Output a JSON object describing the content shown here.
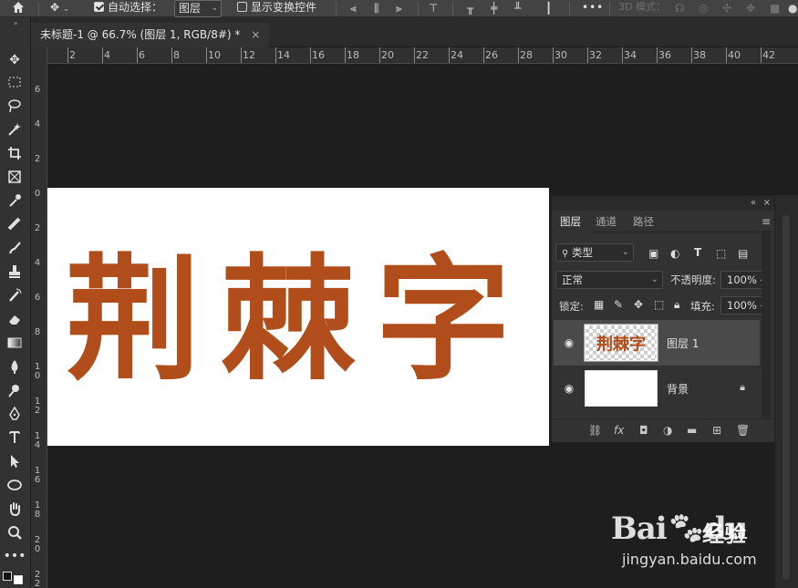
{
  "options_bar": {
    "auto_select_label": "自动选择：",
    "auto_select_checked": true,
    "auto_select_target": "图层",
    "show_transform_label": "显示变换控件",
    "show_transform_checked": false,
    "more_label": "•••",
    "mode_3d_label": "3D 模式："
  },
  "document_tab": {
    "title": "未标题-1 @ 66.7% (图层 1, RGB/8#) *",
    "close_glyph": "×"
  },
  "ruler": {
    "h_labels": [
      "2",
      "4",
      "6",
      "8",
      "10",
      "12",
      "14",
      "16",
      "18",
      "20",
      "22",
      "24",
      "26",
      "28",
      "30",
      "32",
      "34",
      "36",
      "38",
      "40",
      "42"
    ],
    "v_labels": [
      "6",
      "4",
      "2",
      "0",
      "2",
      "4",
      "6",
      "8",
      "10",
      "12",
      "14",
      "16",
      "18",
      "20",
      "22"
    ]
  },
  "canvas": {
    "text": "荆棘字",
    "text_color": "#b04d1a",
    "background": "#ffffff"
  },
  "layers_panel": {
    "collapse_glyph": "«",
    "close_glyph": "×",
    "tabs": [
      {
        "label": "图层",
        "active": true
      },
      {
        "label": "通道",
        "active": false
      },
      {
        "label": "路径",
        "active": false
      }
    ],
    "filter_label": "类型",
    "blend_mode": "正常",
    "opacity_label": "不透明度:",
    "opacity_value": "100%",
    "lock_label": "锁定:",
    "fill_label": "填充:",
    "fill_value": "100%",
    "layers": [
      {
        "name": "图层 1",
        "selected": true,
        "thumbnail_text": "荆棘字",
        "locked": false
      },
      {
        "name": "背景",
        "selected": false,
        "locked": true
      }
    ],
    "footer_icons": [
      "link-icon",
      "fx-icon",
      "mask-icon",
      "adjustment-icon",
      "folder-icon",
      "new-layer-icon",
      "trash-icon"
    ],
    "fx_label": "fx"
  },
  "watermark": {
    "brand": "Bai",
    "brand_suffix": "du",
    "cn": "经验",
    "url": "jingyan.baidu.com"
  }
}
